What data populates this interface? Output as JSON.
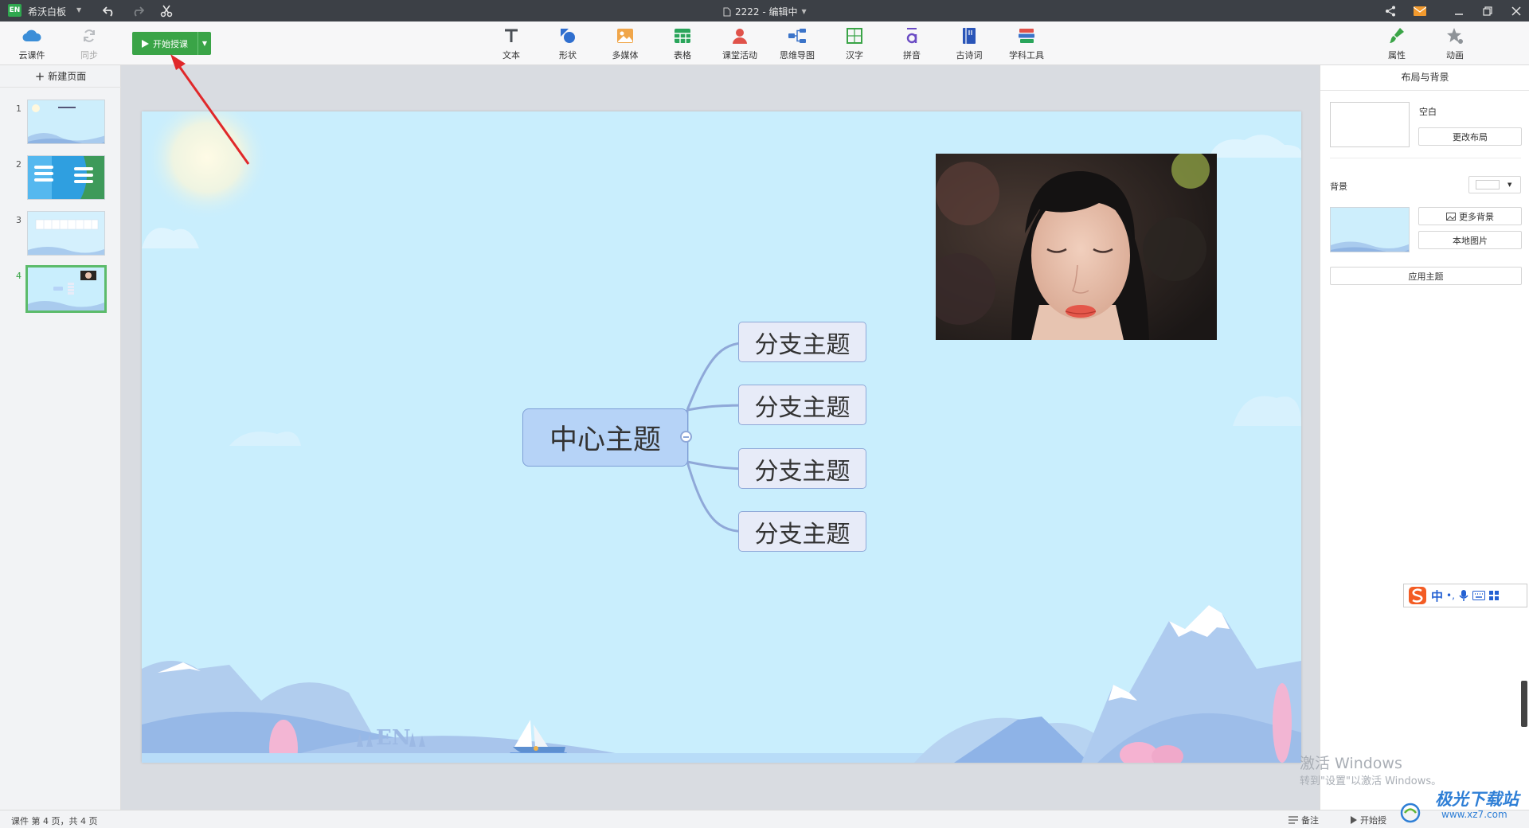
{
  "titlebar": {
    "app_name": "希沃白板",
    "app_logo": "EN",
    "doc_title": "2222 - 编辑中"
  },
  "toolbar": {
    "cloud": "云课件",
    "sync": "同步",
    "start": "开始授课",
    "tools": [
      "文本",
      "形状",
      "多媒体",
      "表格",
      "课堂活动",
      "思维导图",
      "汉字",
      "拼音",
      "古诗词",
      "学科工具"
    ],
    "properties": "属性",
    "animation": "动画"
  },
  "left_panel": {
    "new_page": "新建页面",
    "pages": [
      "1",
      "2",
      "3",
      "4"
    ],
    "active_page": 4
  },
  "slide": {
    "center_topic": "中心主题",
    "branches": [
      "分支主题",
      "分支主题",
      "分支主题",
      "分支主题"
    ],
    "watermark_text": "EN"
  },
  "right_panel": {
    "title": "布局与背景",
    "layout_name": "空白",
    "change_layout": "更改布局",
    "background_label": "背景",
    "more_backgrounds": "更多背景",
    "local_image": "本地图片",
    "apply_theme": "应用主题"
  },
  "ime": {
    "mode": "中"
  },
  "status": {
    "page_info": "课件 第 4 页，共 4 页",
    "notes": "备注",
    "start": "开始授"
  },
  "watermarks": {
    "activate_title": "激活 Windows",
    "activate_sub": "转到\"设置\"以激活 Windows。",
    "site": "极光下载站",
    "site_url": "www.xz7.com"
  },
  "colors": {
    "accent": "#3aa447",
    "slide_bg": "#c9eefd",
    "node_fill": "#b6d3f7",
    "arrow": "#e0282a"
  }
}
